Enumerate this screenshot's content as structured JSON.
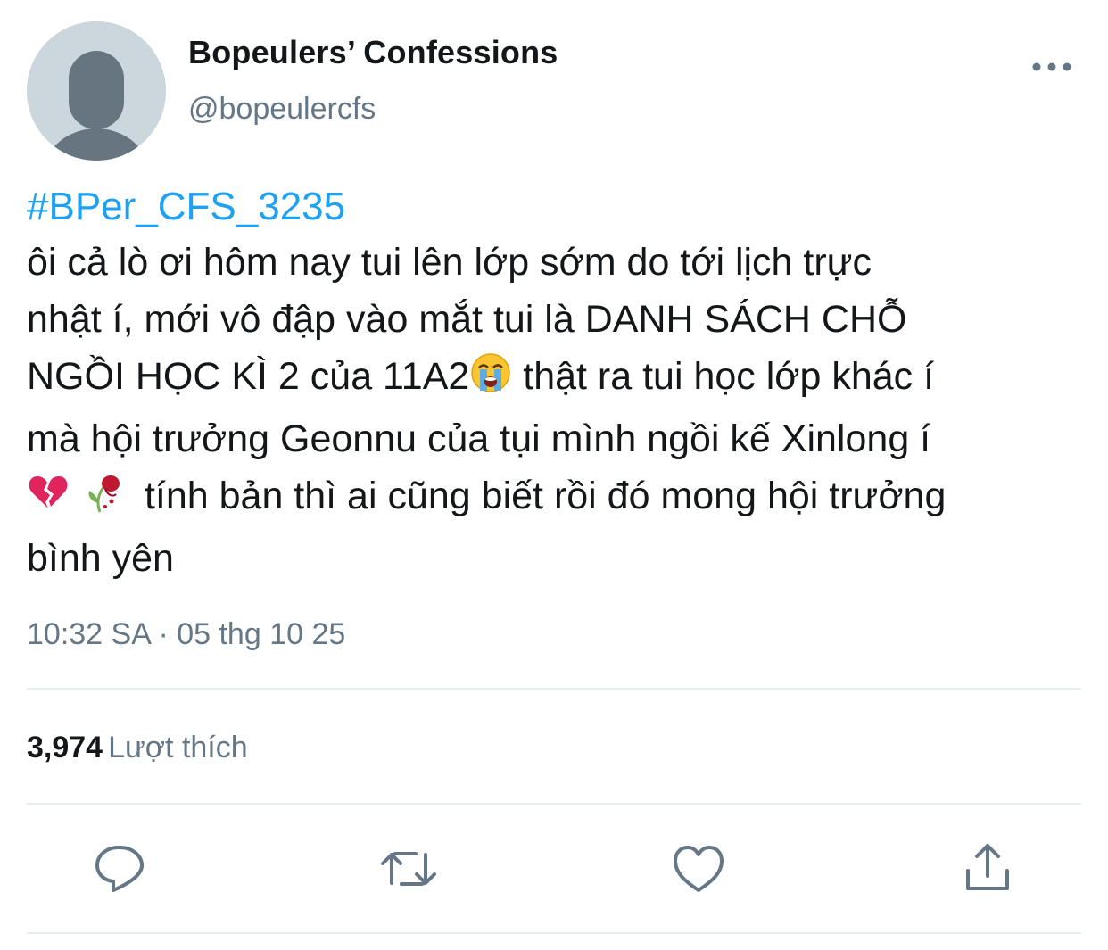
{
  "author": {
    "display_name": "Bopeulers’ Confessions",
    "handle": "@bopeulercfs",
    "avatar_icon": "default-avatar-icon"
  },
  "menu": {
    "icon": "more-horizontal-icon"
  },
  "tweet": {
    "hashtag": "#BPer_CFS_3235",
    "lines": [
      "ôi cả lò ơi hôm nay tui lên lớp sớm do tới lịch trực",
      "nhật í, mới vô đập vào mắt tui là DANH SÁCH CHỖ",
      "NGỒI HỌC KÌ 2 của 11A2",
      "  thật ra tui học lớp khác í",
      "mà hội trưởng Geonnu của tụi mình ngồi kế Xinlong í",
      " tính bản thì ai cũng biết rồi đó mong hội trưởng",
      "bình yên"
    ],
    "emojis": [
      "loudly-crying-face-emoji",
      "broken-heart-emoji",
      "wilted-flower-emoji"
    ],
    "timestamp": "10:32 SA · 05 thg 10 25"
  },
  "stats": {
    "likes_count": "3,974",
    "likes_label": "Lượt thích"
  },
  "actions": {
    "reply_icon": "reply-icon",
    "retweet_icon": "retweet-icon",
    "like_icon": "heart-icon",
    "share_icon": "share-icon"
  },
  "colors": {
    "accent": "#1da1f2",
    "text": "#14171a",
    "secondary": "#657786",
    "divider": "#e6ecf0",
    "avatar_bg": "#ccd6dd",
    "avatar_fg": "#66757f"
  }
}
